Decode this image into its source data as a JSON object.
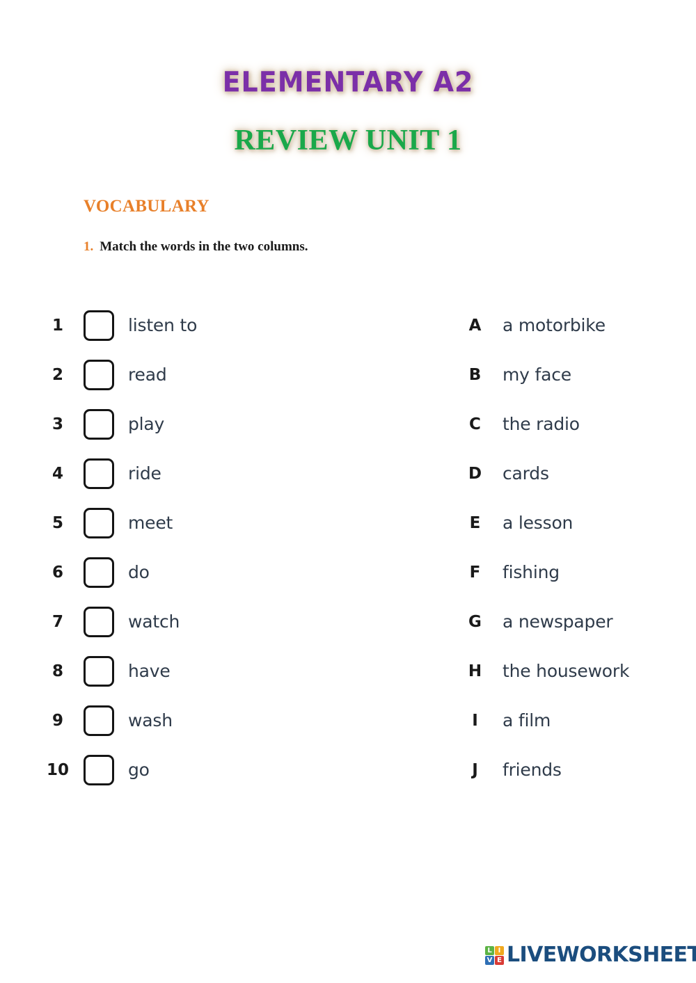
{
  "titles": {
    "main": "ELEMENTARY A2",
    "sub": "REVIEW UNIT 1"
  },
  "section": {
    "heading": "VOCABULARY"
  },
  "instruction": {
    "number": "1.",
    "text": "Match the words in the two columns."
  },
  "exercise": {
    "left_column": [
      {
        "number": "1",
        "word": "listen to",
        "answer": ""
      },
      {
        "number": "2",
        "word": "read",
        "answer": ""
      },
      {
        "number": "3",
        "word": "play",
        "answer": ""
      },
      {
        "number": "4",
        "word": "ride",
        "answer": ""
      },
      {
        "number": "5",
        "word": "meet",
        "answer": ""
      },
      {
        "number": "6",
        "word": "do",
        "answer": ""
      },
      {
        "number": "7",
        "word": "watch",
        "answer": ""
      },
      {
        "number": "8",
        "word": "have",
        "answer": ""
      },
      {
        "number": "9",
        "word": "wash",
        "answer": ""
      },
      {
        "number": "10",
        "word": "go",
        "answer": ""
      }
    ],
    "right_column": [
      {
        "letter": "A",
        "word": "a motorbike"
      },
      {
        "letter": "B",
        "word": "my face"
      },
      {
        "letter": "C",
        "word": "the radio"
      },
      {
        "letter": "D",
        "word": "cards"
      },
      {
        "letter": "E",
        "word": "a lesson"
      },
      {
        "letter": "F",
        "word": "fishing"
      },
      {
        "letter": "G",
        "word": "a newspaper"
      },
      {
        "letter": "H",
        "word": "the housework"
      },
      {
        "letter": "I",
        "word": "a film"
      },
      {
        "letter": "J",
        "word": "friends"
      }
    ]
  },
  "footer": {
    "logo_tiles": [
      "L",
      "I",
      "V",
      "E"
    ],
    "logo_text": "LIVEWORKSHEETS"
  },
  "colors": {
    "title_main": "#7b2fa8",
    "title_sub": "#1aa84a",
    "title_glow": "#d8c7b0",
    "section_heading": "#e8802a",
    "question_number": "#e8802a",
    "body_text": "#1a1a1a",
    "word_text": "#2f3b4a",
    "box_border": "#141414",
    "logo_text": "#1b4d7e",
    "logo_tile_l": "#5bb344",
    "logo_tile_i": "#f0a81e",
    "logo_tile_v": "#2f6fb5",
    "logo_tile_e": "#d93b35",
    "page_background": "#ffffff"
  }
}
